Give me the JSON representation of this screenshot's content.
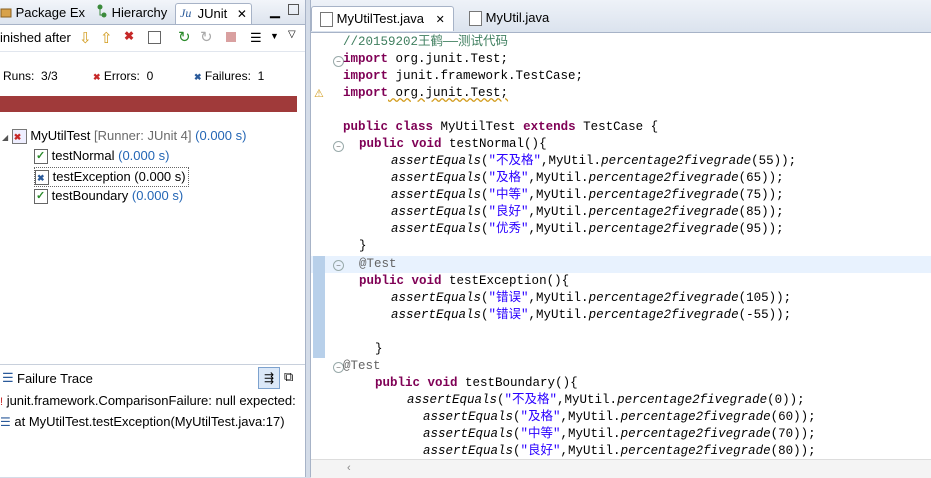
{
  "left_tabs": [
    {
      "label": "Package Ex"
    },
    {
      "label": "Hierarchy"
    },
    {
      "label": "JUnit"
    }
  ],
  "toolbar": {
    "status_label": "inished after"
  },
  "stats": {
    "runs_label": "Runs:",
    "runs_value": "3/3",
    "errors_label": "Errors:",
    "errors_value": "0",
    "failures_label": "Failures:",
    "failures_value": "1"
  },
  "progress": {
    "fraction": 1.0,
    "color": "#a03a3a"
  },
  "tree": {
    "root": {
      "name": "MyUtilTest",
      "runner": "[Runner: JUnit 4]",
      "time": "(0.000 s)"
    },
    "children": [
      {
        "name": "testNormal",
        "time": "(0.000 s)",
        "status": "pass"
      },
      {
        "name": "testException",
        "time": "(0.000 s)",
        "status": "fail"
      },
      {
        "name": "testBoundary",
        "time": "(0.000 s)",
        "status": "pass"
      }
    ]
  },
  "failure_trace": {
    "title": "Failure Trace",
    "lines": [
      "junit.framework.ComparisonFailure: null expected:",
      "at MyUtilTest.testException(MyUtilTest.java:17)"
    ]
  },
  "editor_tabs": [
    {
      "label": "MyUtilTest.java",
      "active": true
    },
    {
      "label": "MyUtil.java",
      "active": false
    }
  ],
  "code": {
    "comment": "//20159202王鹤——测试代码",
    "import1_kw": "import",
    "import1": " org.junit.Test;",
    "import2_kw": "import",
    "import2": " junit.framework.TestCase;",
    "import3_kw": "import",
    "import3": " org.junit.Test;",
    "class_kw1": "public",
    "class_kw2": "class",
    "class_name": " MyUtilTest ",
    "class_kw3": "extends",
    "class_parent": " TestCase {",
    "m1_kw1": "public",
    "m1_kw2": "void",
    "m1_name": " testNormal(){",
    "a_method": "assertEquals",
    "util_call": ",MyUtil.",
    "util_method": "percentage2fivegrade",
    "n1": {
      "str": "\"不及格\"",
      "arg": "(55));"
    },
    "n2": {
      "str": "\"及格\"",
      "arg": "(65));"
    },
    "n3": {
      "str": "\"中等\"",
      "arg": "(75));"
    },
    "n4": {
      "str": "\"良好\"",
      "arg": "(85));"
    },
    "n5": {
      "str": "\"优秀\"",
      "arg": "(95));"
    },
    "close1": "}",
    "ann1": "@Test",
    "m2_kw1": "public",
    "m2_kw2": "void",
    "m2_name": " testException(){",
    "e1": {
      "str": "\"错误\"",
      "arg": "(105));"
    },
    "e2": {
      "str": "\"错误\"",
      "arg": "(-55));"
    },
    "close2": "}",
    "ann2": "@Test",
    "m3_kw1": "public",
    "m3_kw2": "void",
    "m3_name": " testBoundary(){",
    "b1": {
      "str": "\"不及格\"",
      "arg": "(0));"
    },
    "b2": {
      "str": "\"及格\"",
      "arg": "(60));"
    },
    "b3": {
      "str": "\"中等\"",
      "arg": "(70));"
    },
    "b4": {
      "str": "\"良好\"",
      "arg": "(80));"
    }
  }
}
